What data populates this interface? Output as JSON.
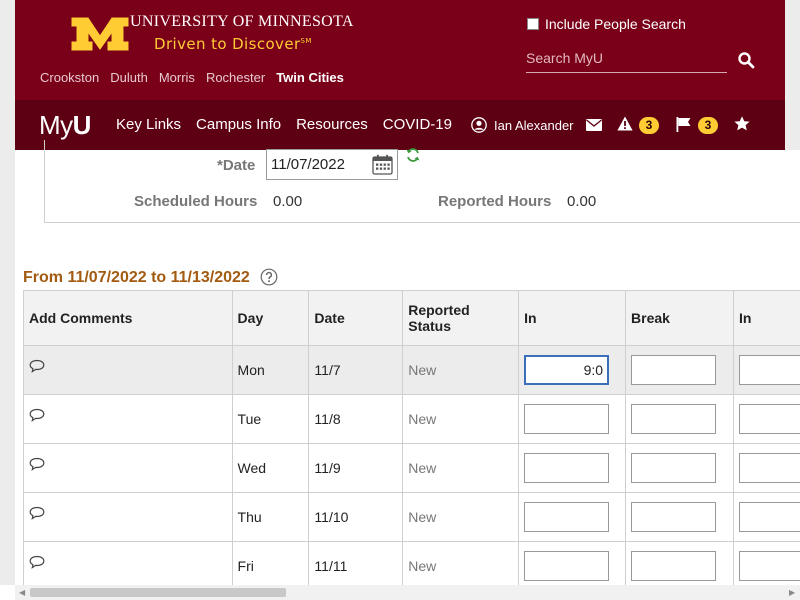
{
  "header": {
    "university_name": "University of Minnesota",
    "tagline": "Driven to Discover",
    "tagline_tm": "SM",
    "campuses": [
      {
        "label": "Crookston",
        "active": false
      },
      {
        "label": "Duluth",
        "active": false
      },
      {
        "label": "Morris",
        "active": false
      },
      {
        "label": "Rochester",
        "active": false
      },
      {
        "label": "Twin Cities",
        "active": true
      }
    ],
    "include_people_search_label": "Include People Search",
    "search_placeholder": "Search MyU"
  },
  "nav": {
    "logo_text_light": "My",
    "logo_text_bold": "U",
    "links": [
      "Key Links",
      "Campus Info",
      "Resources",
      "COVID-19"
    ],
    "user_name": "Ian Alexander",
    "alerts_count": "3",
    "flags_count": "3"
  },
  "form": {
    "date_label": "*Date",
    "date_value": "11/07/2022",
    "scheduled_hours_label": "Scheduled Hours",
    "scheduled_hours_value": "0.00",
    "reported_hours_label": "Reported Hours",
    "reported_hours_value": "0.00"
  },
  "period_title": "From 11/07/2022 to 11/13/2022",
  "table": {
    "headers": {
      "comments": "Add Comments",
      "day": "Day",
      "date": "Date",
      "status_line1": "Reported",
      "status_line2": "Status",
      "in1": "In",
      "break": "Break",
      "in2": "In"
    },
    "rows": [
      {
        "day": "Mon",
        "date": "11/7",
        "status": "New",
        "in": "9:0"
      },
      {
        "day": "Tue",
        "date": "11/8",
        "status": "New",
        "in": ""
      },
      {
        "day": "Wed",
        "date": "11/9",
        "status": "New",
        "in": ""
      },
      {
        "day": "Thu",
        "date": "11/10",
        "status": "New",
        "in": ""
      },
      {
        "day": "Fri",
        "date": "11/11",
        "status": "New",
        "in": ""
      }
    ]
  },
  "colors": {
    "maroon": "#7a0019",
    "nav_maroon": "#5d0013",
    "gold": "#ffcc33",
    "period_text": "#a35b12"
  }
}
